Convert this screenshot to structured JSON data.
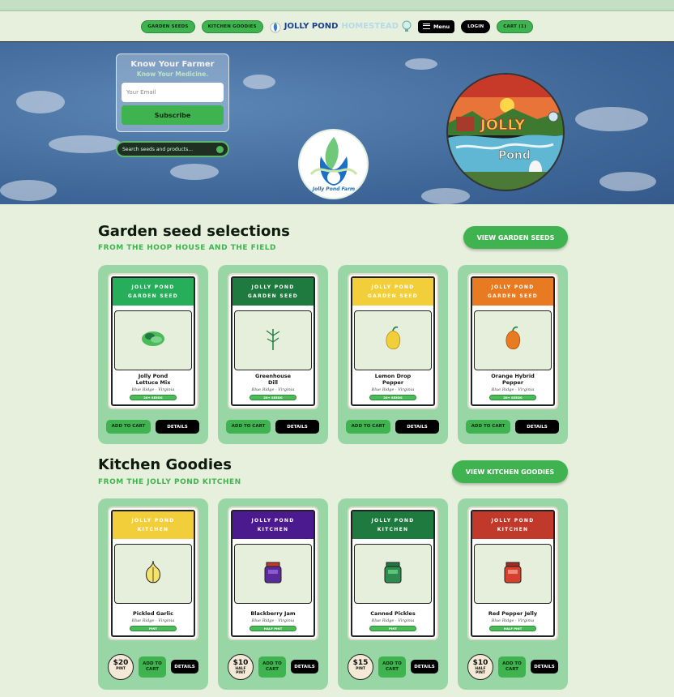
{
  "nav": {
    "garden_seeds": "GARDEN SEEDS",
    "kitchen_goodies": "KITCHEN GOODIES",
    "brand_part1": "JOLLY POND",
    "brand_part2": "HOMESTEAD",
    "menu": "Menu",
    "login": "LOGIN",
    "cart": "CART (1)"
  },
  "hero": {
    "signup_title": "Know Your Farmer",
    "signup_subtitle": "Know Your Medicine.",
    "email_placeholder": "Your Email",
    "subscribe": "Subscribe",
    "search_placeholder": "Search seeds and products...",
    "logo_text": "Jolly Pond Farm"
  },
  "garden": {
    "title": "Garden seed selections",
    "subtitle": "FROM THE HOOP HOUSE AND THE FIELD",
    "view_button": "VIEW GARDEN SEEDS",
    "cards": [
      {
        "brand": "JOLLY POND",
        "kind": "GARDEN SEED",
        "name": "Jolly Pond\nLettuce Mix",
        "location": "Blue Ridge · Virginia",
        "tag": "20+ SEEDS",
        "color": "#27ae5a",
        "icon": "lettuce-icon",
        "add": "ADD TO CART",
        "details": "DETAILS"
      },
      {
        "brand": "JOLLY POND",
        "kind": "GARDEN SEED",
        "name": "Greenhouse\nDill",
        "location": "Blue Ridge · Virginia",
        "tag": "20+ SEEDS",
        "color": "#1e7a3f",
        "icon": "dill-icon",
        "add": "ADD TO CART",
        "details": "DETAILS"
      },
      {
        "brand": "JOLLY POND",
        "kind": "GARDEN SEED",
        "name": "Lemon Drop\nPepper",
        "location": "Blue Ridge · Virginia",
        "tag": "20+ SEEDS",
        "color": "#f2cf3a",
        "icon": "yellow-pepper-icon",
        "add": "ADD TO CART",
        "details": "DETAILS"
      },
      {
        "brand": "JOLLY POND",
        "kind": "GARDEN SEED",
        "name": "Orange Hybrid\nPepper",
        "location": "Blue Ridge · Virginia",
        "tag": "20+ SEEDS",
        "color": "#e87a22",
        "icon": "orange-pepper-icon",
        "add": "ADD TO CART",
        "details": "DETAILS"
      }
    ]
  },
  "kitchen": {
    "title": "Kitchen Goodies",
    "subtitle": "FROM THE JOLLY POND KITCHEN",
    "view_button": "VIEW KITCHEN GOODIES",
    "cards": [
      {
        "brand": "JOLLY POND",
        "kind": "KITCHEN",
        "name": "Pickled Garlic",
        "location": "Blue Ridge · Virginia",
        "tag": "PINT",
        "color": "#f2cf3a",
        "icon": "garlic-icon",
        "price": "$20",
        "unit": "PINT",
        "add": "ADD TO CART",
        "details": "DETAILS"
      },
      {
        "brand": "JOLLY POND",
        "kind": "KITCHEN",
        "name": "Blackberry Jam",
        "location": "Blue Ridge · Virginia",
        "tag": "HALF PINT",
        "color": "#4b1a8f",
        "icon": "purple-jar-icon",
        "price": "$10",
        "unit": "HALF PINT",
        "add": "ADD TO CART",
        "details": "DETAILS"
      },
      {
        "brand": "JOLLY POND",
        "kind": "KITCHEN",
        "name": "Canned Pickles",
        "location": "Blue Ridge · Virginia",
        "tag": "PINT",
        "color": "#1e7a3f",
        "icon": "green-jar-icon",
        "price": "$15",
        "unit": "PINT",
        "add": "ADD TO CART",
        "details": "DETAILS"
      },
      {
        "brand": "JOLLY POND",
        "kind": "KITCHEN",
        "name": "Red Pepper Jelly",
        "location": "Blue Ridge · Virginia",
        "tag": "HALF PINT",
        "color": "#c0392b",
        "icon": "red-jar-icon",
        "price": "$10",
        "unit": "HALF PINT",
        "add": "ADD TO CART",
        "details": "DETAILS"
      }
    ]
  }
}
